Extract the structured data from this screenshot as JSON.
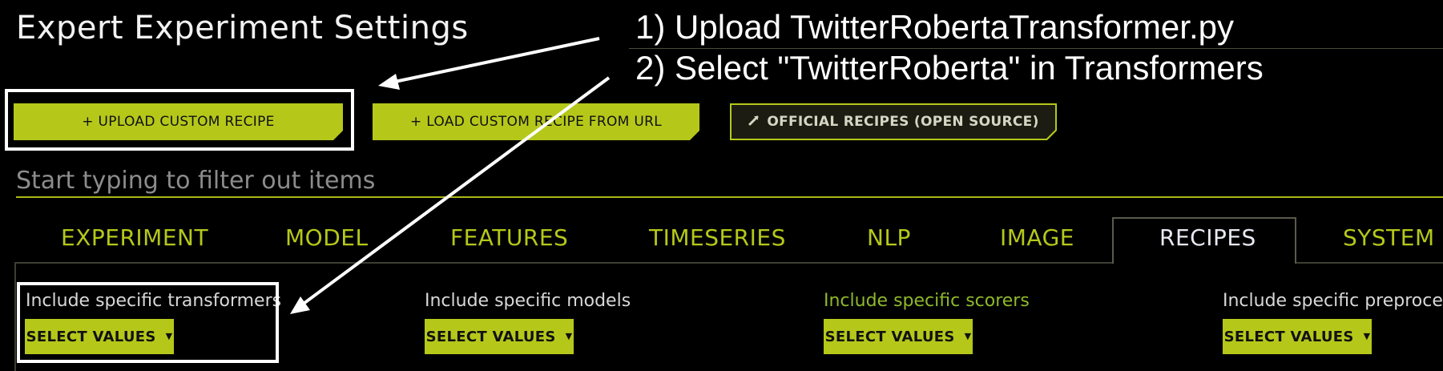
{
  "page_title": "Expert Experiment Settings",
  "annotations": {
    "step1": "1) Upload TwitterRobertaTransformer.py",
    "step2": "2) Select \"TwitterRoberta\" in Transformers"
  },
  "recipe_buttons": {
    "upload": "+ UPLOAD CUSTOM RECIPE",
    "load_url": "+ LOAD CUSTOM RECIPE FROM URL",
    "official": "OFFICIAL RECIPES (OPEN SOURCE)"
  },
  "filter": {
    "placeholder": "Start typing to filter out items"
  },
  "tabs": [
    {
      "label": "EXPERIMENT"
    },
    {
      "label": "MODEL"
    },
    {
      "label": "FEATURES"
    },
    {
      "label": "TIMESERIES"
    },
    {
      "label": "NLP"
    },
    {
      "label": "IMAGE"
    },
    {
      "label": "RECIPES",
      "active": true
    },
    {
      "label": "SYSTEM"
    }
  ],
  "fields": [
    {
      "label": "Include specific transformers",
      "button": "SELECT VALUES"
    },
    {
      "label": "Include specific models",
      "button": "SELECT VALUES"
    },
    {
      "label": "Include specific scorers",
      "button": "SELECT VALUES"
    },
    {
      "label": "Include specific preprocess",
      "button": "SELECT VALUES"
    }
  ],
  "colors": {
    "accent": "#b5c81a",
    "background": "#000000",
    "scorers_label": "#8fb82a",
    "annotation": "#ffffff"
  },
  "icons": {
    "official_recipes": "external-link-icon",
    "dropdown": "caret-down-icon"
  }
}
